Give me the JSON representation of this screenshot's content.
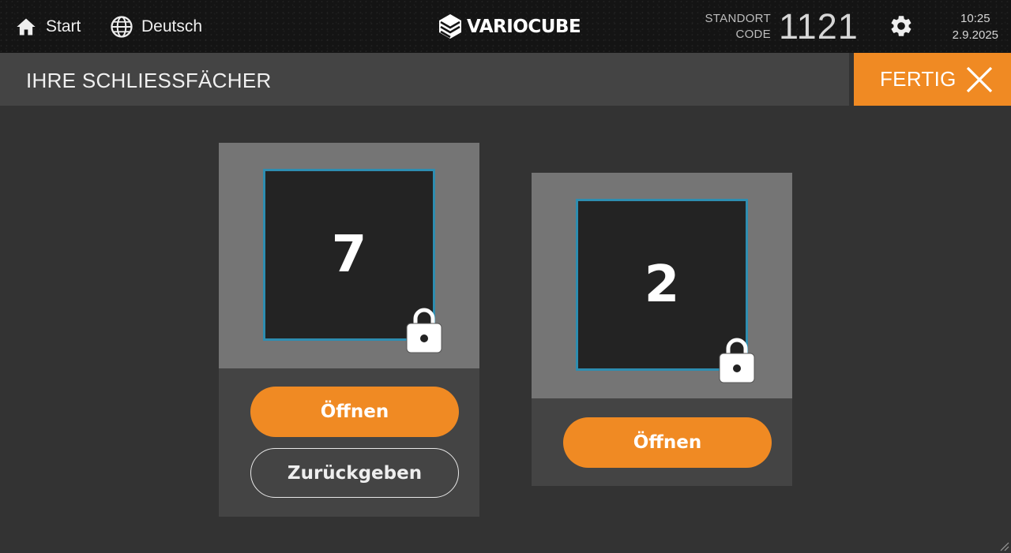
{
  "header": {
    "home_label": "Start",
    "language_label": "Deutsch",
    "brand": "VARIOCUBE",
    "location_label_line1": "STANDORT",
    "location_label_line2": "CODE",
    "location_code": "1121",
    "time": "10:25",
    "date": "2.9.2025"
  },
  "titlebar": {
    "title": "IHRE SCHLIESSFÄCHER",
    "done_label": "FERTIG"
  },
  "lockers": [
    {
      "number": "7",
      "locked": true,
      "open_label": "Öffnen",
      "return_label": "Zurückgeben"
    },
    {
      "number": "2",
      "locked": true,
      "open_label": "Öffnen"
    }
  ],
  "colors": {
    "accent": "#f08a23",
    "locker_border": "#2e8db0",
    "background": "#333333"
  },
  "icons": [
    "home-icon",
    "globe-icon",
    "gear-icon",
    "close-icon",
    "lock-icon"
  ]
}
